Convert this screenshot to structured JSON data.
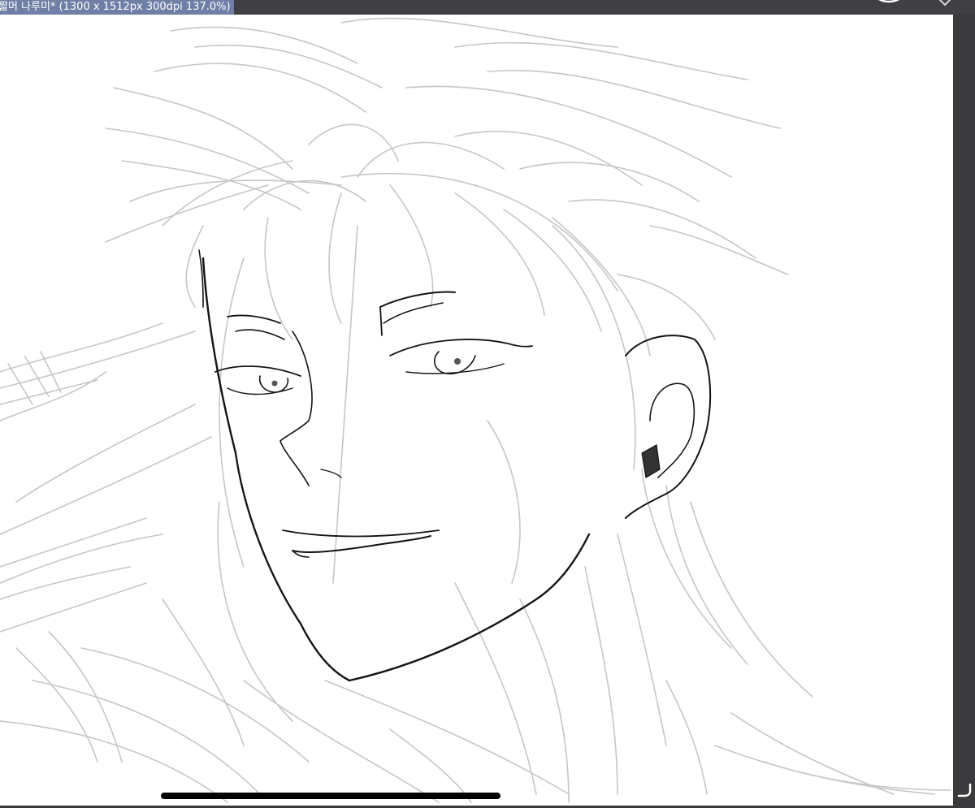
{
  "document_tab": {
    "title": "짧머 나루미* (1300 x 1512px 300dpi 137.0%)"
  },
  "toolbar": {
    "profile_icon": "circle-icon",
    "menu_icon": "chevron-down-icon"
  },
  "canvas": {
    "background": "#ffffff",
    "sketch_color": "#c4c4c4",
    "lineart_color": "#111111"
  },
  "colors": {
    "tab_background": "#6f7fa5",
    "chrome": "#3d3d40",
    "home_indicator": "#000000"
  }
}
